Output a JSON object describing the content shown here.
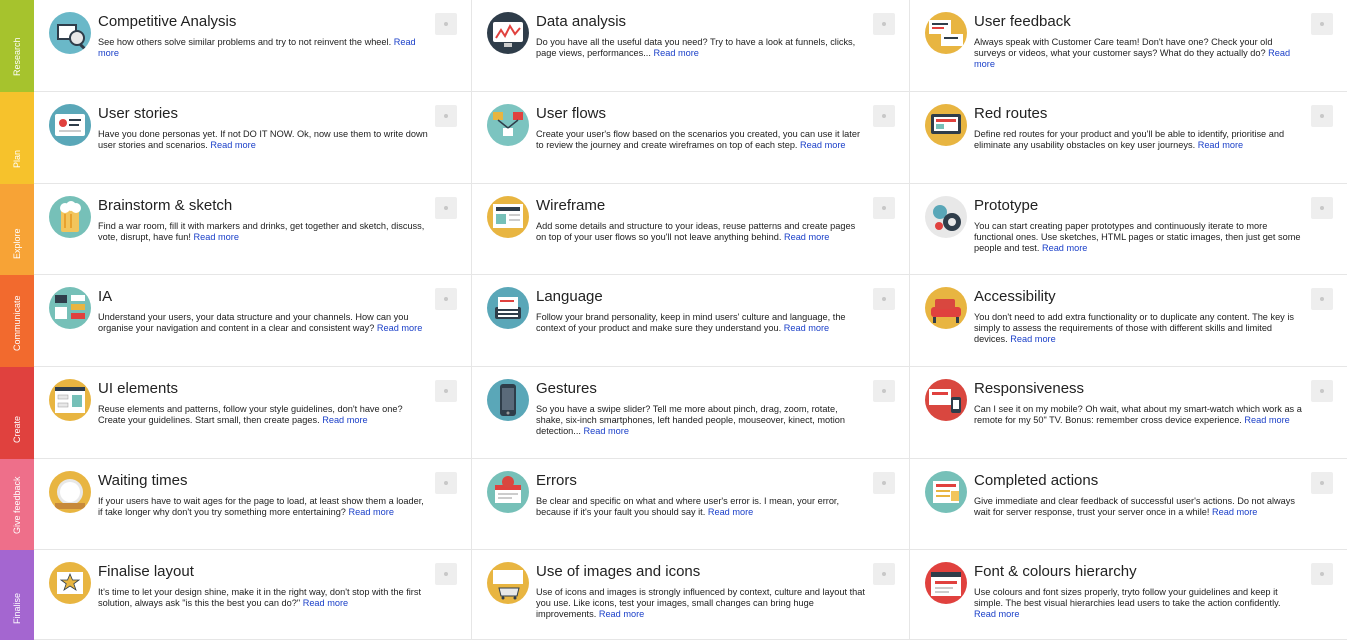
{
  "read_more": "Read more",
  "stages": [
    {
      "label": "Research",
      "color": "#a6c32d",
      "cards": [
        {
          "title": "Competitive Analysis",
          "desc": "See how others solve similar problems and try to not reinvent the wheel.",
          "icon": "competitive-analysis-icon",
          "icon_bg": "#6ab8c8"
        },
        {
          "title": "Data analysis",
          "desc": "Do you have all the useful data you need? Try to have a look at funnels, clicks, page views, performances...",
          "icon": "data-analysis-icon",
          "icon_bg": "#2f3d4a"
        },
        {
          "title": "User feedback",
          "desc": "Always speak with Customer Care team! Don't have one? Check your old surveys or videos, what your customer says? What do they actually do?",
          "icon": "user-feedback-icon",
          "icon_bg": "#e8b541"
        }
      ]
    },
    {
      "label": "Plan",
      "color": "#f6c22c",
      "cards": [
        {
          "title": "User stories",
          "desc": "Have you done personas yet. If not DO IT NOW. Ok, now use them to write down user stories and scenarios.",
          "icon": "user-stories-icon",
          "icon_bg": "#5aa7b8"
        },
        {
          "title": "User flows",
          "desc": "Create your user's flow based on the scenarios you created, you can use it later to review the journey and create wireframes on top of each step.",
          "icon": "user-flows-icon",
          "icon_bg": "#7cc4c0"
        },
        {
          "title": "Red routes",
          "desc": "Define red routes for your product and you'll be able to identify, prioritise and eliminate any usability obstacles on key user journeys.",
          "icon": "red-routes-icon",
          "icon_bg": "#e8b541"
        }
      ]
    },
    {
      "label": "Explore",
      "color": "#f7a336",
      "cards": [
        {
          "title": "Brainstorm & sketch",
          "desc": "Find a war room, fill it with markers and drinks, get together and sketch, discuss, vote, disrupt, have fun!",
          "icon": "brainstorm-icon",
          "icon_bg": "#76c0b8"
        },
        {
          "title": "Wireframe",
          "desc": "Add some details and structure to your ideas, reuse patterns and create pages on top of your user flows so you'll not leave anything behind.",
          "icon": "wireframe-icon",
          "icon_bg": "#e8b541"
        },
        {
          "title": "Prototype",
          "desc": "You can start creating paper prototypes and continuously iterate to more functional ones. Use sketches, HTML pages or static images, then just get some people and test.",
          "icon": "prototype-icon",
          "icon_bg": "#e8e8e8"
        }
      ]
    },
    {
      "label": "Communicate",
      "color": "#f26a2e",
      "cards": [
        {
          "title": "IA",
          "desc": "Understand your users, your data structure and your channels. How can you organise your navigation and content in a clear and consistent way?",
          "icon": "ia-icon",
          "icon_bg": "#76c0b8"
        },
        {
          "title": "Language",
          "desc": "Follow your brand personality, keep in mind users' culture and language, the context of your product and make sure they understand you.",
          "icon": "language-icon",
          "icon_bg": "#5aa7b8"
        },
        {
          "title": "Accessibility",
          "desc": "You don't need to add extra functionality or to duplicate any content. The key is simply to assess the requirements of those with different skills and limited devices.",
          "icon": "accessibility-icon",
          "icon_bg": "#e8b541"
        }
      ]
    },
    {
      "label": "Create",
      "color": "#e0413e",
      "cards": [
        {
          "title": "UI elements",
          "desc": "Reuse elements and patterns, follow your style guidelines, don't have one? Create your guidelines. Start small, then create pages.",
          "icon": "ui-elements-icon",
          "icon_bg": "#e8b541"
        },
        {
          "title": "Gestures",
          "desc": "So you have a swipe slider? Tell me more about pinch, drag, zoom, rotate, shake, six-inch smartphones, left handed people, mouseover, kinect, motion detection...",
          "icon": "gestures-icon",
          "icon_bg": "#5aa7b8"
        },
        {
          "title": "Responsiveness",
          "desc": "Can I see it on my mobile? Oh wait, what about my smart-watch which work as a remote for my 50\" TV. Bonus: remember cross device experience.",
          "icon": "responsiveness-icon",
          "icon_bg": "#d9473f"
        }
      ]
    },
    {
      "label": "Give feedback",
      "color": "#ee6f8a",
      "cards": [
        {
          "title": "Waiting times",
          "desc": "If your users have to wait ages for the page to load, at least show them a loader, if take longer why don't you try something more entertaining?",
          "icon": "waiting-times-icon",
          "icon_bg": "#e8b541"
        },
        {
          "title": "Errors",
          "desc": "Be clear and specific on what and where user's error is. I mean, your error, because if it's your fault you should say it.",
          "icon": "errors-icon",
          "icon_bg": "#76c0b8"
        },
        {
          "title": "Completed actions",
          "desc": "Give immediate and clear feedback of successful user's actions. Do not always wait for server response, trust your server once in a while!",
          "icon": "completed-actions-icon",
          "icon_bg": "#76c0b8"
        }
      ]
    },
    {
      "label": "Finalise",
      "color": "#a466d0",
      "cards": [
        {
          "title": "Finalise layout",
          "desc": "It's time to let your design shine, make it in the right way, don't stop with the first solution, always ask \"is this the best you can do?\"",
          "icon": "finalise-layout-icon",
          "icon_bg": "#e8b541"
        },
        {
          "title": "Use of images and icons",
          "desc": "Use of icons and images is strongly influenced by context, culture and layout that you use. Like icons, test your images, small changes can bring huge improvements.",
          "icon": "images-icons-icon",
          "icon_bg": "#e8b541"
        },
        {
          "title": "Font & colours hierarchy",
          "desc": "Use colours and font sizes properly, tryto follow your guidelines and keep it simple. The best visual hierarchies lead users to take the action confidently.",
          "icon": "font-colours-icon",
          "icon_bg": "#e0413e"
        }
      ]
    }
  ]
}
